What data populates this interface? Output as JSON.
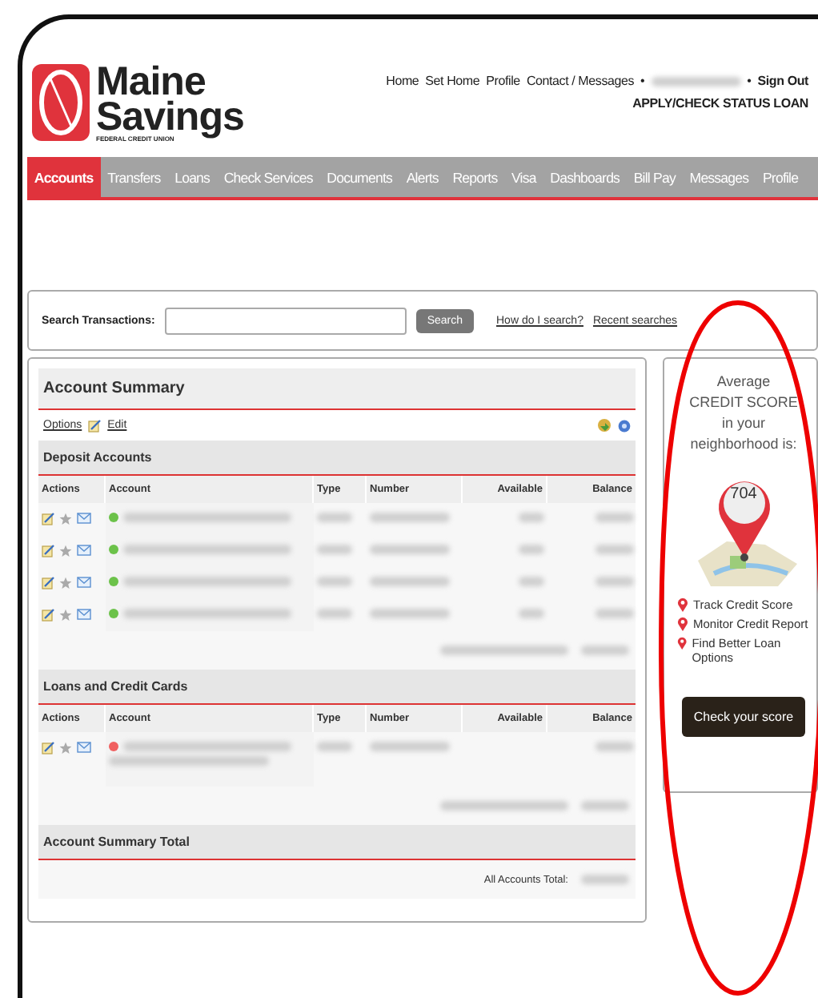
{
  "logo": {
    "line1": "Maine",
    "line2": "Savings",
    "tagline": "FEDERAL CREDIT UNION"
  },
  "top_links": [
    "Home",
    "Set Home",
    "Profile",
    "Contact / Messages"
  ],
  "separators": [
    "•",
    "•"
  ],
  "sign_out": "Sign Out",
  "apply_link": "APPLY/CHECK STATUS LOAN",
  "nav": [
    {
      "label": "Accounts",
      "selected": true
    },
    {
      "label": "Transfers",
      "selected": false
    },
    {
      "label": "Loans",
      "selected": false
    },
    {
      "label": "Check Services",
      "selected": false
    },
    {
      "label": "Documents",
      "selected": false
    },
    {
      "label": "Alerts",
      "selected": false
    },
    {
      "label": "Reports",
      "selected": false
    },
    {
      "label": "Visa",
      "selected": false
    },
    {
      "label": "Dashboards",
      "selected": false
    },
    {
      "label": "Bill Pay",
      "selected": false
    },
    {
      "label": "Messages",
      "selected": false
    },
    {
      "label": "Profile",
      "selected": false
    }
  ],
  "search": {
    "label": "Search Transactions:",
    "button": "Search",
    "links": [
      "How do I search?",
      "Recent searches"
    ]
  },
  "summary": {
    "title": "Account Summary",
    "options": "Options",
    "edit": "Edit",
    "sections": [
      {
        "title": "Deposit Accounts",
        "columns": [
          "Actions",
          "Account",
          "Type",
          "Number",
          "Available",
          "Balance"
        ],
        "rows": [
          {
            "color": "#6cc24a",
            "note": false
          },
          {
            "color": "#6cc24a",
            "note": false
          },
          {
            "color": "#6cc24a",
            "note": false
          },
          {
            "color": "#6cc24a",
            "note": false
          }
        ]
      },
      {
        "title": "Loans and Credit Cards",
        "columns": [
          "Actions",
          "Account",
          "Type",
          "Number",
          "Available",
          "Balance"
        ],
        "rows": [
          {
            "color": "#f06060",
            "note": true
          }
        ]
      }
    ],
    "total_title": "Account Summary Total",
    "total_label": "All Accounts Total:"
  },
  "promo": {
    "text": "Average CREDIT SCORE in your neighborhood is:",
    "score": "704",
    "bullets": [
      "Track Credit Score",
      "Monitor Credit Report",
      "Find Better Loan Options"
    ],
    "button": "Check your score"
  }
}
